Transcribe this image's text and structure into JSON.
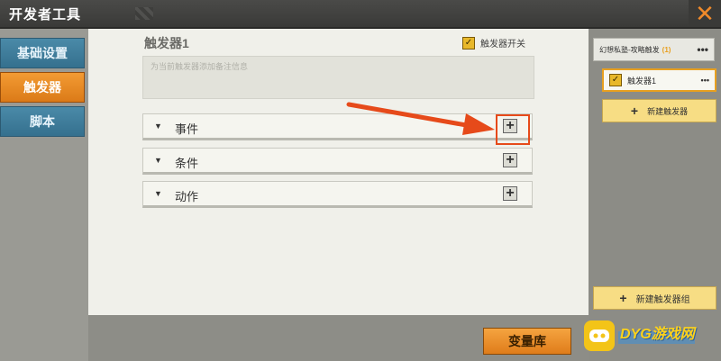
{
  "window": {
    "title": "开发者工具",
    "close_glyph": "✕"
  },
  "sidebar": {
    "items": [
      {
        "label": "基础设置",
        "active": false
      },
      {
        "label": "触发器",
        "active": true
      },
      {
        "label": "脚本",
        "active": false
      }
    ]
  },
  "editor": {
    "trigger_name": "触发器1",
    "enable_label": "触发器开关",
    "enable_checked": true,
    "remark_placeholder": "为当前触发器添加备注信息",
    "sections": [
      {
        "label": "事件",
        "icon": "caret-down-icon"
      },
      {
        "label": "条件",
        "icon": "caret-down-icon"
      },
      {
        "label": "动作",
        "icon": "caret-down-icon"
      }
    ]
  },
  "bottom": {
    "variable_library_label": "变量库"
  },
  "right_panel": {
    "group_name": "幻想私塾-攻略触发",
    "group_count": "(1)",
    "more_glyph": "•••",
    "trigger_item": "触发器1",
    "new_trigger_label": "新建触发器",
    "new_group_label": "新建触发器组"
  },
  "watermark": {
    "text": "DYG游戏网"
  },
  "colors": {
    "accent_orange": "#f39b33",
    "tab_blue": "#4a8aa8",
    "annotation_red": "#e64a1a",
    "button_yellow": "#f7dd84"
  }
}
